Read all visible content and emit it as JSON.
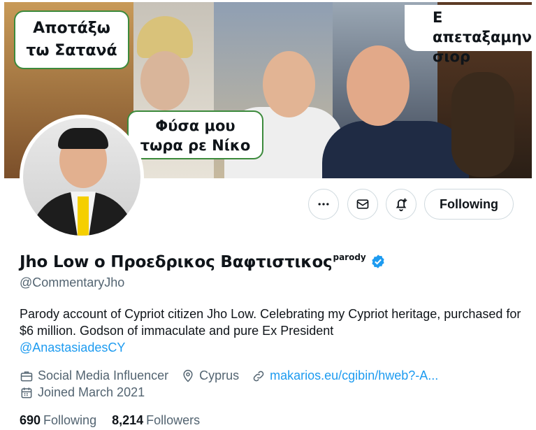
{
  "banner": {
    "bubble_left": [
      "Αποτάξω",
      "τω Σατανά"
    ],
    "bubble_center": [
      "Φύσα μου",
      "τωρα ρε Νίκο"
    ],
    "bubble_right": [
      "Ε απεταξαμην",
      "σιορ"
    ]
  },
  "actions": {
    "more_icon": "more-icon",
    "message_icon": "mail-icon",
    "notify_icon": "bell-plus-icon",
    "follow_label": "Following"
  },
  "profile": {
    "name": "Jho Low ο Προεδρικος Βαφτιστικος",
    "label": "parody",
    "handle": "@CommentaryJho",
    "bio_text": "Parody account of Cypriot citizen Jho Low. Celebrating my Cypriot heritage, purchased for $6 million. Godson of immaculate and pure Ex President",
    "bio_mention": "@AnastasiadesCY",
    "category": "Social Media Influencer",
    "location": "Cyprus",
    "website": "makarios.eu/cgibin/hweb?-A...",
    "joined": "Joined March 2021",
    "following_count": "690",
    "following_label": "Following",
    "followers_count": "8,214",
    "followers_label": "Followers"
  },
  "colors": {
    "link": "#1d9bf0",
    "muted": "#536471",
    "text": "#0f1419",
    "verified": "#1d9bf0"
  }
}
